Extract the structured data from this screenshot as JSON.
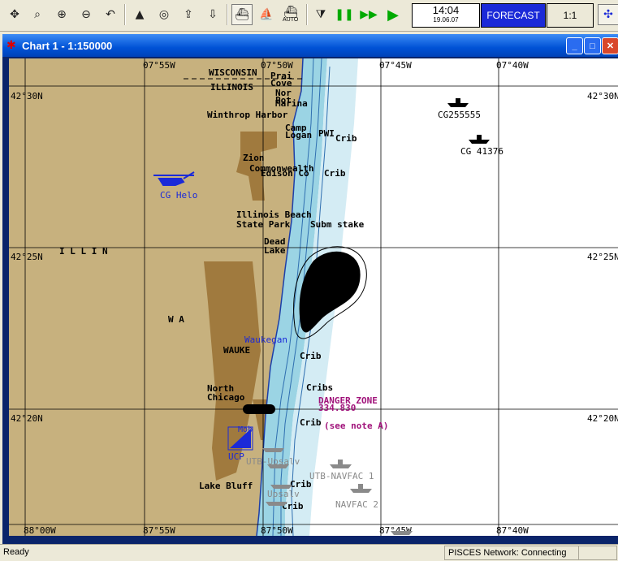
{
  "toolbar": {
    "icons": [
      "pan-icon",
      "zoom-box-icon",
      "zoom-in-icon",
      "zoom-out-icon",
      "undo-icon",
      "north-icon",
      "center-icon",
      "export-icon",
      "import-icon",
      "ship-view-icon",
      "ship-profile-icon",
      "auto-ship-icon",
      "step-down-icon",
      "pause-icon",
      "fast-forward-icon",
      "play-icon"
    ],
    "auto_label": "AUTO",
    "clock_time": "14:04",
    "clock_date": "19.06.07",
    "forecast_label": "FORECAST",
    "scale_label": "1:1"
  },
  "window": {
    "title": "Chart 1 - 1:150000",
    "controls": [
      "minimize",
      "maximize",
      "close"
    ]
  },
  "chart": {
    "lat_labels": [
      "42°30N",
      "42°25N",
      "42°20N",
      "42°30N",
      "42°25N",
      "42°20N"
    ],
    "lon_labels_top": [
      "07°55W",
      "07°50W",
      "07°45W",
      "07°40W"
    ],
    "lon_labels_bottom": [
      "88°00W",
      "87°55W",
      "87°50W",
      "87°45W",
      "87°40W"
    ],
    "place_labels": [
      "WISCONSIN",
      "ILLINOIS",
      "Prai",
      "Cove",
      "Nor",
      "Pot",
      "Marina",
      "Winthrop Harbor",
      "Camp",
      "Logan",
      "PWI",
      "Crib",
      "Zion",
      "Commonwealth",
      "Edison Co",
      "Crib",
      "Illinois Beach",
      "State Park",
      "Subm stake",
      "Dead",
      "Lake",
      "I  L  L  I  N",
      "W A",
      "WAUKE",
      "Waukegan",
      "Crib",
      "North",
      "Chicago",
      "Cribs",
      "Crib",
      "Lake Bluff",
      "Crib",
      "Crib"
    ],
    "danger_zone_title": "DANGER ZONE",
    "danger_zone_freq": "334.830",
    "danger_zone_note": "(see note A)",
    "vessel_labels": [
      "CG255555",
      "CG 41376",
      "CG Helo",
      "UCP",
      "Mob",
      "UTB-NAVFAC 1",
      "NAVFAC 2",
      "UTB-Upsalv",
      "Upsalv"
    ]
  },
  "status": {
    "left": "Ready",
    "network": "PISCES Network: Connecting"
  }
}
